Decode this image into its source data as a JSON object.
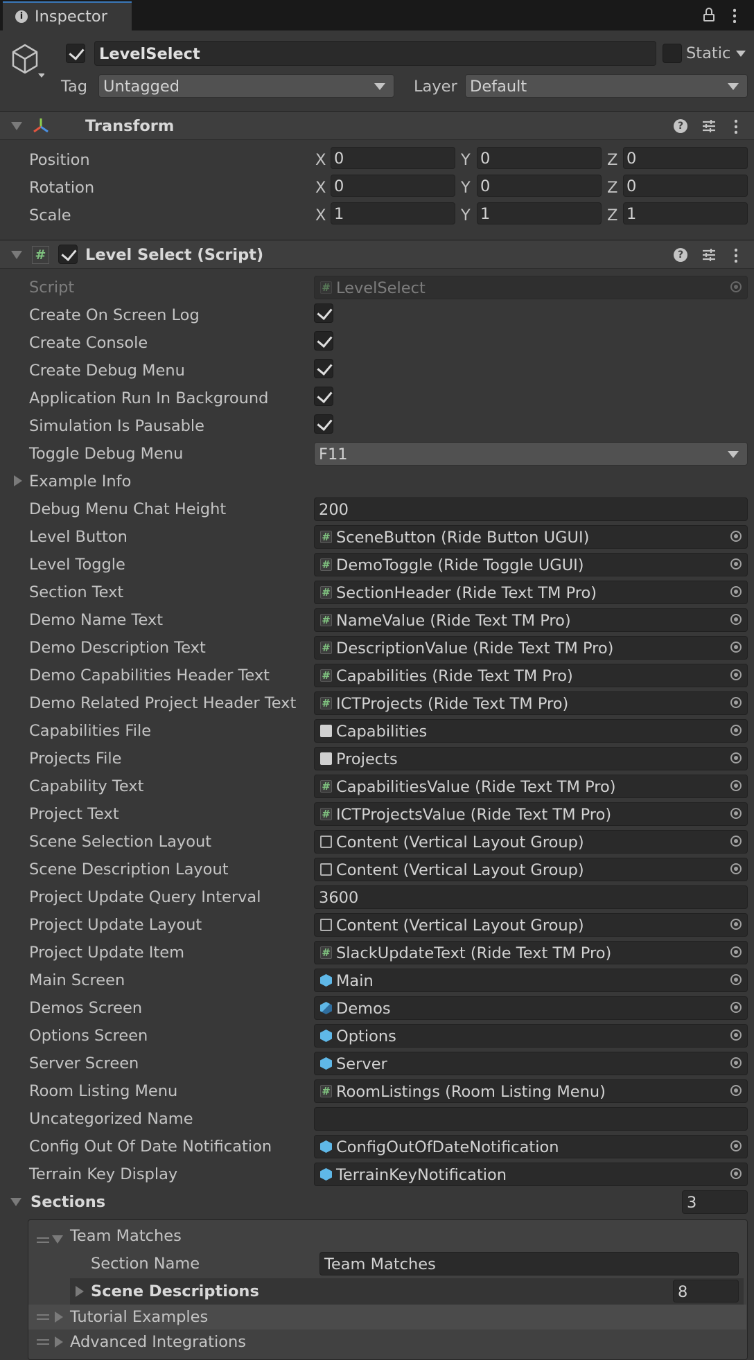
{
  "tab": {
    "title": "Inspector"
  },
  "header": {
    "object_name": "LevelSelect",
    "active": true,
    "static_label": "Static",
    "tag_label": "Tag",
    "tag_value": "Untagged",
    "layer_label": "Layer",
    "layer_value": "Default"
  },
  "transform": {
    "title": "Transform",
    "rows": [
      {
        "label": "Position",
        "x": "0",
        "y": "0",
        "z": "0"
      },
      {
        "label": "Rotation",
        "x": "0",
        "y": "0",
        "z": "0"
      },
      {
        "label": "Scale",
        "x": "1",
        "y": "1",
        "z": "1"
      }
    ],
    "axis_x": "X",
    "axis_y": "Y",
    "axis_z": "Z"
  },
  "script_component": {
    "title": "Level Select (Script)",
    "enabled": true,
    "script_label": "Script",
    "script_value": "LevelSelect",
    "checkboxes": [
      {
        "label": "Create On Screen Log",
        "checked": true
      },
      {
        "label": "Create Console",
        "checked": true
      },
      {
        "label": "Create Debug Menu",
        "checked": true
      },
      {
        "label": "Application Run In Background",
        "checked": true
      },
      {
        "label": "Simulation Is Pausable",
        "checked": true
      }
    ],
    "toggle_debug_menu": {
      "label": "Toggle Debug Menu",
      "value": "F11"
    },
    "example_info": {
      "label": "Example Info"
    },
    "debug_chat_height": {
      "label": "Debug Menu Chat Height",
      "value": "200"
    },
    "object_fields_a": [
      {
        "label": "Level Button",
        "value": "SceneButton (Ride Button UGUI)",
        "icon": "script-icon"
      },
      {
        "label": "Level Toggle",
        "value": "DemoToggle (Ride Toggle UGUI)",
        "icon": "script-icon"
      },
      {
        "label": "Section Text",
        "value": "SectionHeader (Ride Text TM Pro)",
        "icon": "script-icon"
      },
      {
        "label": "Demo Name Text",
        "value": "NameValue (Ride Text TM Pro)",
        "icon": "script-icon"
      },
      {
        "label": "Demo Description Text",
        "value": "DescriptionValue (Ride Text TM Pro)",
        "icon": "script-icon"
      },
      {
        "label": "Demo Capabilities Header Text",
        "value": "Capabilities (Ride Text TM Pro)",
        "icon": "script-icon"
      },
      {
        "label": "Demo Related Project Header Text",
        "value": "ICTProjects (Ride Text TM Pro)",
        "icon": "script-icon"
      },
      {
        "label": "Capabilities File",
        "value": "Capabilities",
        "icon": "text-asset-icon"
      },
      {
        "label": "Projects File",
        "value": "Projects",
        "icon": "text-asset-icon"
      },
      {
        "label": "Capability Text",
        "value": "CapabilitiesValue (Ride Text TM Pro)",
        "icon": "script-icon"
      },
      {
        "label": "Project Text",
        "value": "ICTProjectsValue (Ride Text TM Pro)",
        "icon": "script-icon"
      },
      {
        "label": "Scene Selection Layout",
        "value": "Content (Vertical Layout Group)",
        "icon": "layout-icon"
      },
      {
        "label": "Scene Description Layout",
        "value": "Content (Vertical Layout Group)",
        "icon": "layout-icon"
      }
    ],
    "query_interval": {
      "label": "Project Update Query Interval",
      "value": "3600"
    },
    "object_fields_b": [
      {
        "label": "Project Update Layout",
        "value": "Content (Vertical Layout Group)",
        "icon": "layout-icon"
      },
      {
        "label": "Project Update Item",
        "value": "SlackUpdateText (Ride Text TM Pro)",
        "icon": "script-icon"
      },
      {
        "label": "Main Screen",
        "value": "Main",
        "icon": "prefab-icon"
      },
      {
        "label": "Demos Screen",
        "value": "Demos",
        "icon": "prefab-variant-icon"
      },
      {
        "label": "Options Screen",
        "value": "Options",
        "icon": "prefab-icon"
      },
      {
        "label": "Server Screen",
        "value": "Server",
        "icon": "prefab-icon"
      },
      {
        "label": "Room Listing Menu",
        "value": "RoomListings (Room Listing Menu)",
        "icon": "script-icon"
      }
    ],
    "uncategorized_name": {
      "label": "Uncategorized Name",
      "value": ""
    },
    "object_fields_c": [
      {
        "label": "Config Out Of Date Notification",
        "value": "ConfigOutOfDateNotification",
        "icon": "prefab-icon"
      },
      {
        "label": "Terrain Key Display",
        "value": "TerrainKeyNotification",
        "icon": "prefab-icon"
      }
    ],
    "sections": {
      "label": "Sections",
      "count": "3",
      "items": [
        {
          "title": "Team Matches",
          "expanded": true,
          "section_name_label": "Section Name",
          "section_name_value": "Team Matches",
          "scene_descriptions_label": "Scene Descriptions",
          "scene_descriptions_count": "8"
        },
        {
          "title": "Tutorial Examples",
          "expanded": false
        },
        {
          "title": "Advanced Integrations",
          "expanded": false
        }
      ]
    }
  },
  "colors": {
    "background": "#383838",
    "header": "#3e3e3e",
    "field": "#2a2a2a",
    "text": "#c4c4c4",
    "accent": "#3a79bb"
  }
}
